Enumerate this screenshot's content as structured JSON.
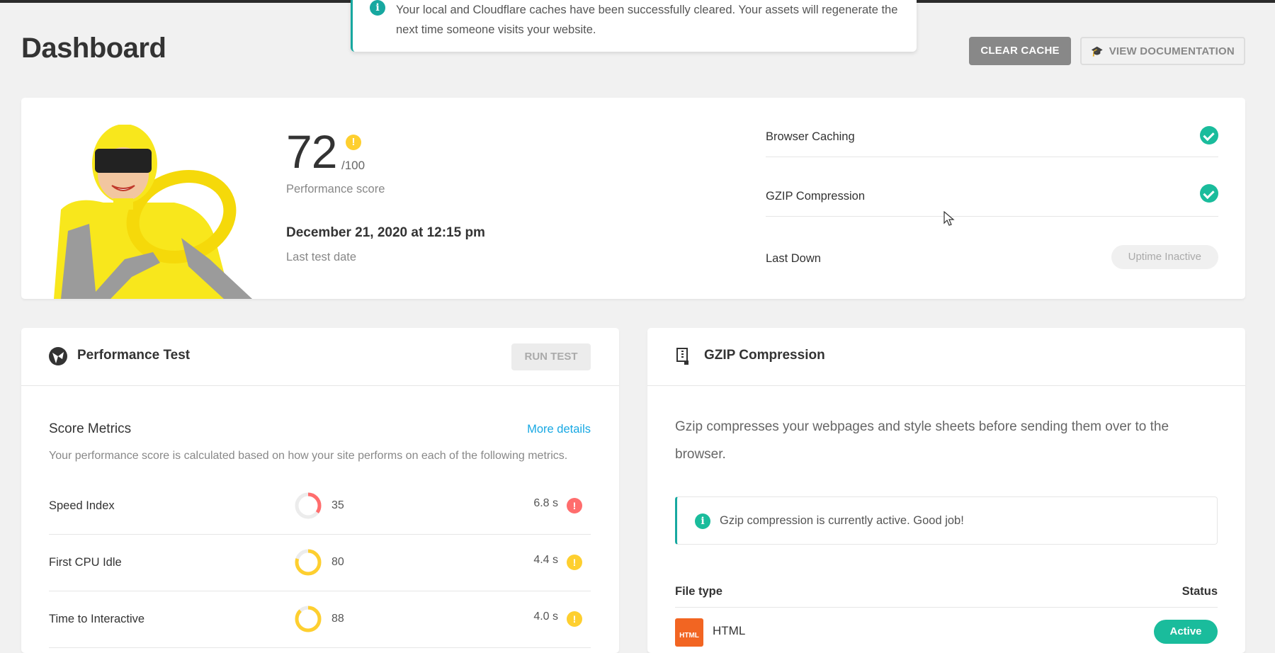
{
  "notice": {
    "text": "Your local and Cloudflare caches have been successfully cleared. Your assets will regenerate the next time someone visits your website.",
    "icon": "info-icon"
  },
  "header": {
    "title": "Dashboard",
    "clear_cache_label": "CLEAR CACHE",
    "docs_label": "VIEW DOCUMENTATION",
    "docs_icon": "graduation-cap-icon"
  },
  "summary": {
    "score": "72",
    "score_denominator": "/100",
    "score_label": "Performance score",
    "score_warning": "!",
    "last_test_date": "December 21, 2020 at 12:15 pm",
    "last_test_label": "Last test date",
    "stats": [
      {
        "label": "Browser Caching",
        "state": "ok"
      },
      {
        "label": "GZIP Compression",
        "state": "ok"
      },
      {
        "label": "Last Down",
        "state": "pill",
        "pill_label": "Uptime Inactive"
      }
    ]
  },
  "performance": {
    "title": "Performance Test",
    "run_label": "RUN TEST",
    "metrics_title": "Score Metrics",
    "more_details": "More details",
    "description": "Your performance score is calculated based on how your site performs on each of the following metrics.",
    "metrics": [
      {
        "name": "Speed Index",
        "score": "35",
        "score_value": 35,
        "time": "6.8 s",
        "level": "red",
        "color": "#ff6d6d"
      },
      {
        "name": "First CPU Idle",
        "score": "80",
        "score_value": 80,
        "time": "4.4 s",
        "level": "yellow",
        "color": "#fecf2f"
      },
      {
        "name": "Time to Interactive",
        "score": "88",
        "score_value": 88,
        "time": "4.0 s",
        "level": "yellow",
        "color": "#fecf2f"
      }
    ]
  },
  "gzip": {
    "title": "GZIP Compression",
    "description": "Gzip compresses your webpages and style sheets before sending them over to the browser.",
    "notice": "Gzip compression is currently active. Good job!",
    "col_file_type": "File type",
    "col_status": "Status",
    "rows": [
      {
        "badge": "HTML",
        "name": "HTML",
        "status": "Active"
      }
    ]
  },
  "colors": {
    "accent": "#17a8a0",
    "success": "#1abc9c",
    "warning": "#fecf2f",
    "error": "#ff6d6d",
    "link": "#17a8e3"
  }
}
